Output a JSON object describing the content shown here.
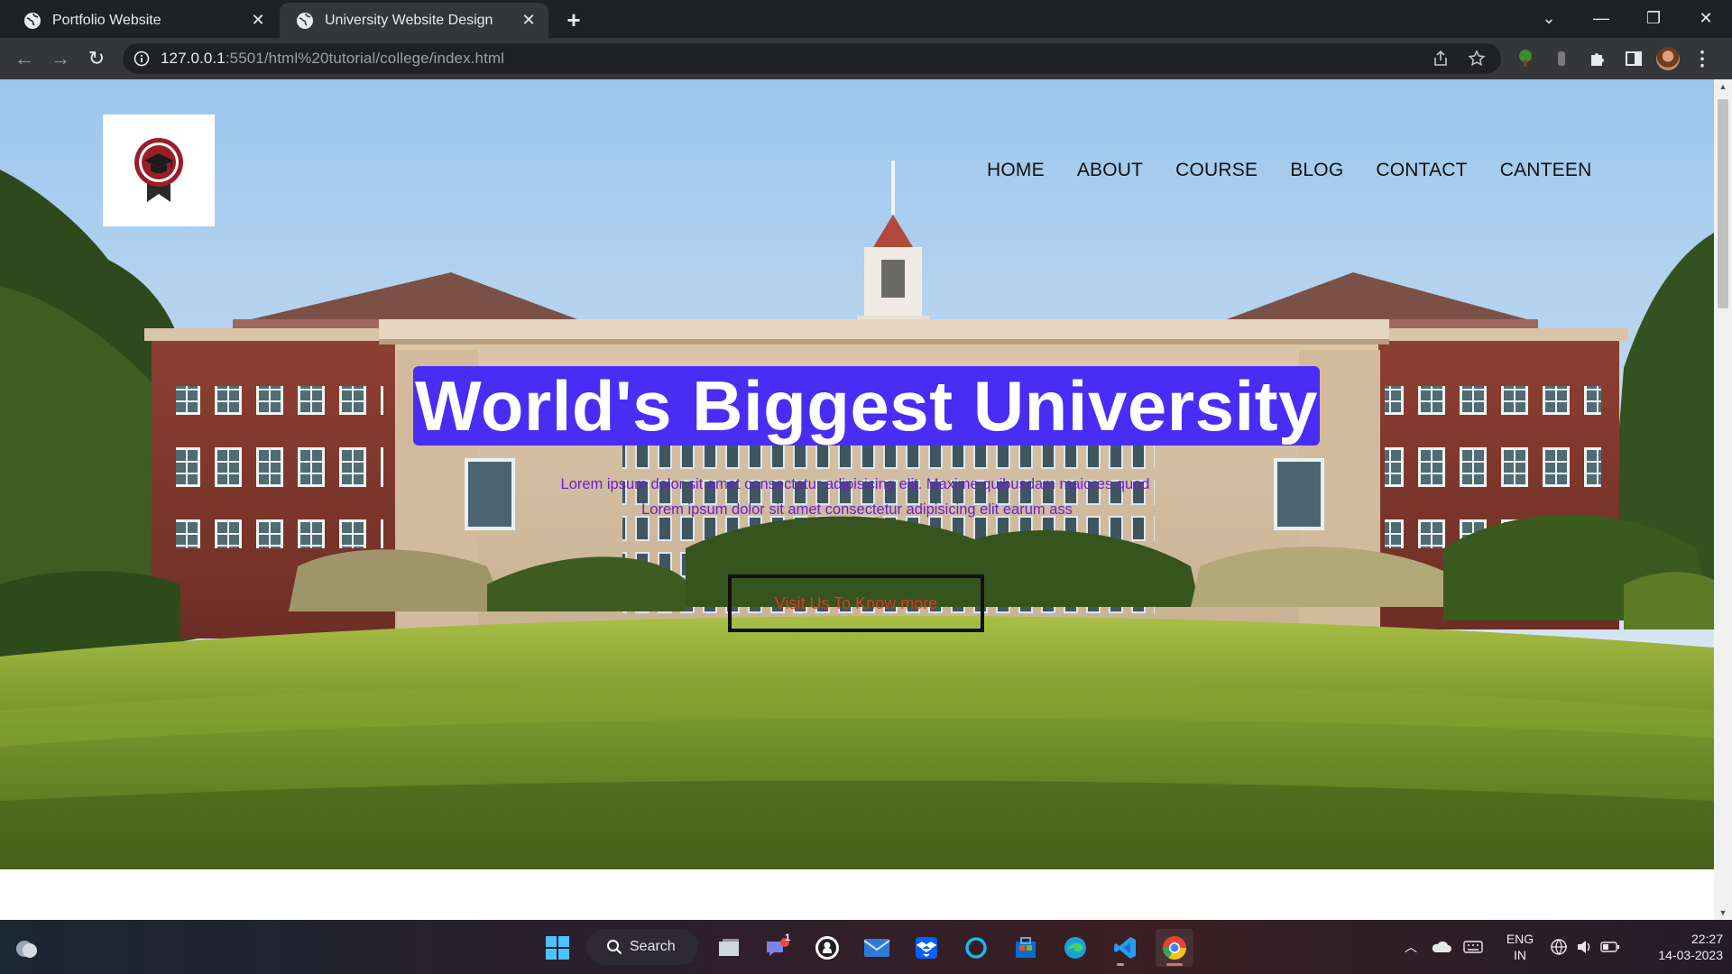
{
  "browser": {
    "tabs": [
      {
        "title": "Portfolio Website",
        "active": false
      },
      {
        "title": "University Website Design",
        "active": true
      }
    ],
    "url_host": "127.0.0.1",
    "url_path": ":5501/html%20tutorial/college/index.html"
  },
  "site": {
    "nav": [
      "HOME",
      "ABOUT",
      "COURSE",
      "BLOG",
      "CONTACT",
      "CANTEEN"
    ],
    "headline": "World's Biggest University",
    "lorem_line1": "Lorem ipsum dolor sit amet consectetur adipisicing elit. Maxime quibusdam maiores quod",
    "lorem_line2": "Lorem ipsum dolor sit amet consectetur adipisicing elit earum ass",
    "cta": "Visit Us To Know more",
    "colors": {
      "headline_bg": "#4a2df5",
      "lorem": "#6a1fd0",
      "cta_text": "#e2362a"
    }
  },
  "taskbar": {
    "search": "Search",
    "chat_badge": "1",
    "lang_line1": "ENG",
    "lang_line2": "IN",
    "time": "22:27",
    "date": "14-03-2023"
  }
}
